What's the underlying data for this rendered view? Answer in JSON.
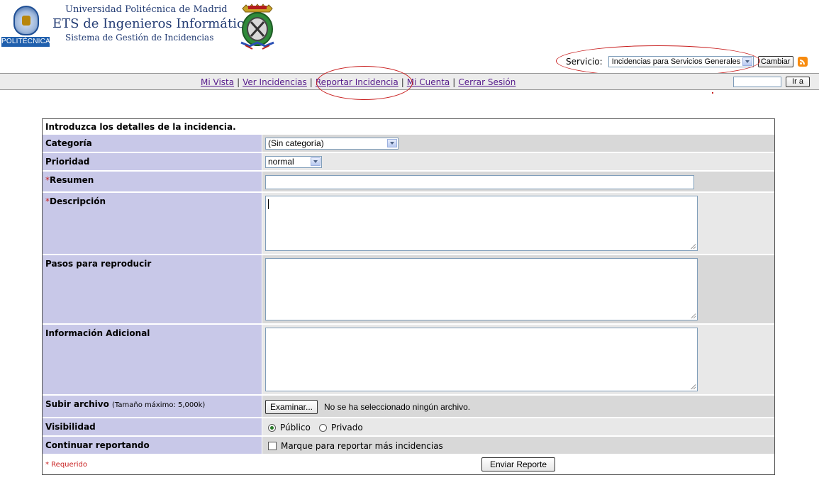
{
  "header": {
    "logo_text": "POLITÉCNICA",
    "university": "Universidad Politécnica de Madrid",
    "school": "ETS de Ingenieros Informáticos",
    "system": "Sistema de Gestión de Incidencias"
  },
  "service": {
    "label": "Servicio:",
    "selected": "Incidencias para Servicios Generales",
    "change_button": "Cambiar"
  },
  "nav": {
    "items": [
      "Mi Vista",
      "Ver Incidencias",
      "Reportar Incidencia",
      "Mi Cuenta",
      "Cerrar Sesión"
    ],
    "separator": "|",
    "go_button": "Ir a"
  },
  "form": {
    "title": "Introduzca los detalles de la incidencia.",
    "category_label": "Categoría",
    "category_value": "(Sin categoría)",
    "priority_label": "Prioridad",
    "priority_value": "normal",
    "required_mark": "*",
    "summary_label": "Resumen",
    "description_label": "Descripción",
    "steps_label": "Pasos para reproducir",
    "additional_label": "Información Adicional",
    "upload_label": "Subir archivo",
    "upload_note": "(Tamaño máximo: 5,000k)",
    "browse_button": "Examinar...",
    "no_file": "No se ha seleccionado ningún archivo.",
    "visibility_label": "Visibilidad",
    "visibility_public": "Público",
    "visibility_private": "Privado",
    "continue_label": "Continuar reportando",
    "continue_checkbox": "Marque para reportar más incidencias",
    "required_note": "* Requerido",
    "submit_button": "Enviar Reporte"
  }
}
